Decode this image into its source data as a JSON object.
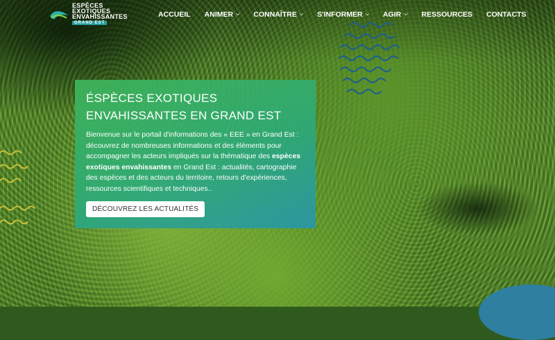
{
  "logo": {
    "line1": "ESPÈCES",
    "line2": "EXOTIQUES",
    "line3": "ENVAHISSANTES",
    "sub": "GRAND EST"
  },
  "nav": [
    {
      "label": "ACCUEIL",
      "dropdown": false
    },
    {
      "label": "ANIMER",
      "dropdown": true
    },
    {
      "label": "CONNAÎTRE",
      "dropdown": true
    },
    {
      "label": "S'INFORMER",
      "dropdown": true
    },
    {
      "label": "AGIR",
      "dropdown": true
    },
    {
      "label": "RESSOURCES",
      "dropdown": false
    },
    {
      "label": "CONTACTS",
      "dropdown": false
    }
  ],
  "hero": {
    "title_line1": "ÉSPÈCES EXOTIQUES",
    "title_line2": "ENVAHISSANTES EN GRAND EST",
    "text_part1": "Bienvenue sur le portail d'informations des « EEE » en Grand Est : découvrez de nombreuses informations et des éléments pour accompagner les acteurs impliqués sur la thématique des ",
    "text_bold": "espèces exotiques envahissantes",
    "text_part2": " en Grand Est : actualités, cartographie des espèces et des acteurs du territoire, retours d'expériences, ressources scientifiques et techniques..",
    "button_label": "DÉCOUVREZ LES ACTUALITÉS"
  },
  "colors": {
    "card_start": "#3eb65a",
    "card_end": "#2896aa",
    "wave": "#1f5f8a"
  }
}
